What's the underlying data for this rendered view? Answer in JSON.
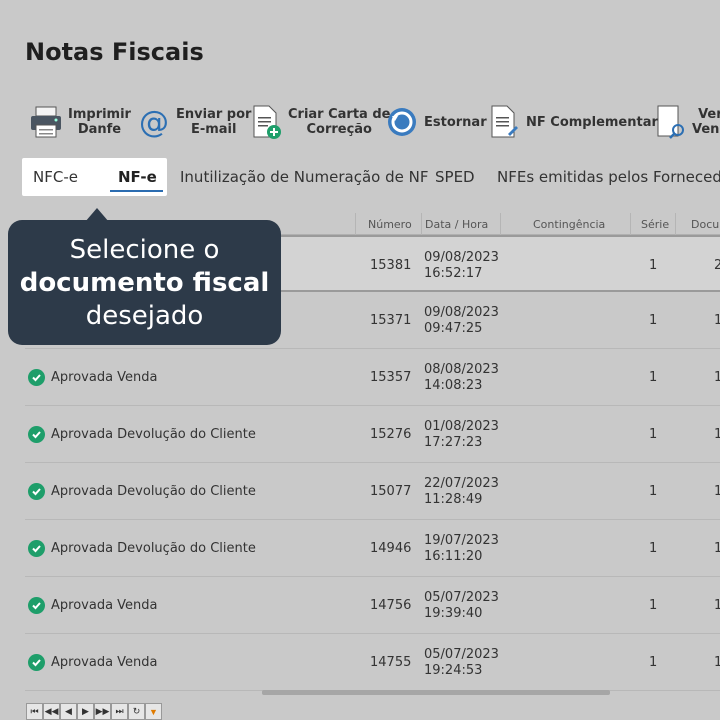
{
  "page": {
    "title": "Notas Fiscais"
  },
  "toolbar": {
    "buttons": [
      {
        "label": "Imprimir\nDanfe",
        "icon": "printer-icon"
      },
      {
        "label": "Enviar por\nE-mail",
        "icon": "at-sign-icon"
      },
      {
        "label": "Criar Carta de\nCorreção",
        "icon": "document-add-icon"
      },
      {
        "label": "Estornar",
        "icon": "undo-icon"
      },
      {
        "label": "NF Complementar",
        "icon": "document-pin-icon"
      },
      {
        "label": "Ver\nVend",
        "icon": "search-document-icon"
      }
    ]
  },
  "tabs": [
    "NFC-e",
    "NF-e",
    "Inutilização de Numeração de NF",
    "SPED",
    "NFEs emitidas pelos Fornecedo"
  ],
  "active_tab": "NF-e",
  "tooltip": {
    "line1": "Selecione o",
    "line2": "documento fiscal",
    "line3": "desejado"
  },
  "grid": {
    "columns": [
      "Número",
      "Data / Hora",
      "Contingência",
      "Série",
      "Docu"
    ],
    "rows": [
      {
        "status": "",
        "numero": "15381",
        "data": "09/08/2023",
        "hora": "16:52:17",
        "serie": "1",
        "doc": "2"
      },
      {
        "status": "",
        "numero": "15371",
        "data": "09/08/2023",
        "hora": "09:47:25",
        "serie": "1",
        "doc": "1"
      },
      {
        "status": "Aprovada  Venda",
        "numero": "15357",
        "data": "08/08/2023",
        "hora": "14:08:23",
        "serie": "1",
        "doc": "1"
      },
      {
        "status": "Aprovada  Devolução do Cliente",
        "numero": "15276",
        "data": "01/08/2023",
        "hora": "17:27:23",
        "serie": "1",
        "doc": "1"
      },
      {
        "status": "Aprovada  Devolução do Cliente",
        "numero": "15077",
        "data": "22/07/2023",
        "hora": "11:28:49",
        "serie": "1",
        "doc": "1"
      },
      {
        "status": "Aprovada  Devolução do Cliente",
        "numero": "14946",
        "data": "19/07/2023",
        "hora": "16:11:20",
        "serie": "1",
        "doc": "1"
      },
      {
        "status": "Aprovada  Venda",
        "numero": "14756",
        "data": "05/07/2023",
        "hora": "19:39:40",
        "serie": "1",
        "doc": "1"
      },
      {
        "status": "Aprovada  Venda",
        "numero": "14755",
        "data": "05/07/2023",
        "hora": "19:24:53",
        "serie": "1",
        "doc": "1"
      }
    ]
  },
  "pager": [
    "⏮",
    "◀◀",
    "◀",
    "▶",
    "▶▶",
    "⏭",
    "↻",
    "▼"
  ],
  "colors": {
    "accent": "#2b6cb0",
    "tooltip_bg": "#2d3a49",
    "approved": "#1e9e6a"
  }
}
